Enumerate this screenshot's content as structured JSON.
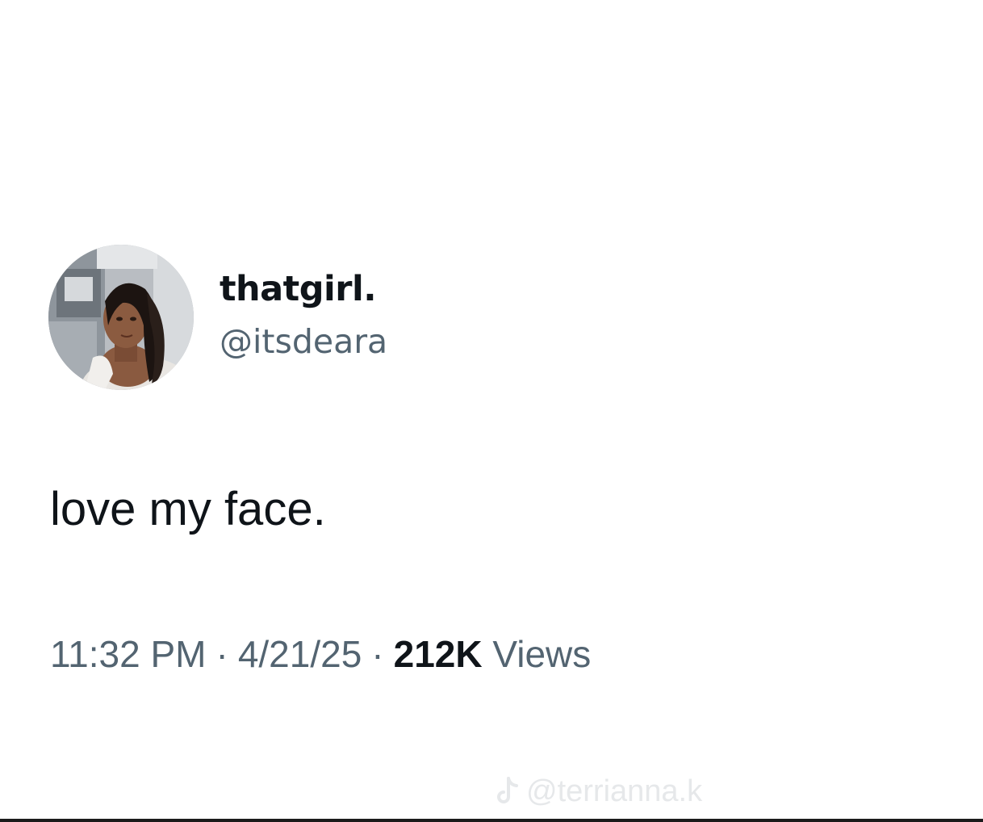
{
  "tweet": {
    "author": {
      "display_name": "thatgirl.",
      "handle": "@itsdeara",
      "avatar_icon": "profile-photo"
    },
    "text": "love my face.",
    "meta": {
      "time": "11:32 PM",
      "separator": "·",
      "date": "4/21/25",
      "views_count": "212K",
      "views_label": "Views"
    }
  },
  "watermark": {
    "icon": "tiktok-icon",
    "text": "@terrianna.k"
  },
  "colors": {
    "primary_text": "#0f1419",
    "secondary_text": "#536471",
    "background": "#ffffff",
    "watermark": "#e6e8ea"
  }
}
